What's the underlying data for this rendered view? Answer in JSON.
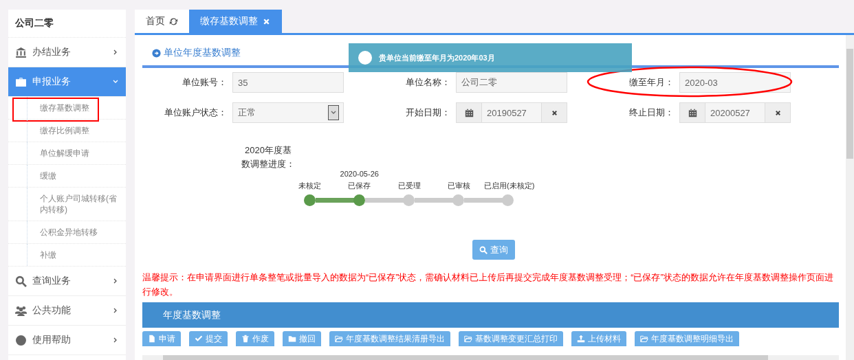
{
  "sidebar": {
    "title": "公司二零",
    "items": [
      {
        "label": "办结业务",
        "expanded": false,
        "selected": false
      },
      {
        "label": "申报业务",
        "expanded": true,
        "selected": true,
        "children": [
          {
            "label": "缴存基数调整",
            "annotated": true
          },
          {
            "label": "缴存比例调整",
            "annotated": false
          },
          {
            "label": "单位解缓申请",
            "annotated": false
          },
          {
            "label": "缓缴",
            "annotated": false
          },
          {
            "label": "个人账户司城转移(省内转移)",
            "annotated": false
          },
          {
            "label": "公积金异地转移",
            "annotated": false
          },
          {
            "label": "补缴",
            "annotated": false
          }
        ]
      },
      {
        "label": "查询业务",
        "expanded": false,
        "selected": false
      },
      {
        "label": "公共功能",
        "expanded": false,
        "selected": false
      },
      {
        "label": "使用帮助",
        "expanded": false,
        "selected": false
      }
    ]
  },
  "tabs": [
    {
      "label": "首页",
      "selected": false
    },
    {
      "label": "缴存基数调整",
      "selected": true
    }
  ],
  "section_title": "单位年度基数调整",
  "toast": {
    "message": "贵单位当前缴至年月为2020年03月"
  },
  "form": {
    "fields": [
      {
        "label": "单位账号：",
        "kind": "text",
        "value": "35"
      },
      {
        "label": "单位名称：",
        "kind": "text",
        "value": "公司二零"
      },
      {
        "label": "缴至年月：",
        "kind": "text",
        "value": "2020-03",
        "annotated": true
      },
      {
        "label": "单位账户状态：",
        "kind": "select",
        "value": "正常"
      },
      {
        "label": "开始日期：",
        "kind": "date",
        "value": "20190527"
      },
      {
        "label": "终止日期：",
        "kind": "date",
        "value": "20200527"
      }
    ]
  },
  "progress": {
    "label": "2020年度基数调整进度：",
    "steps": [
      {
        "label": "未核定",
        "done": true
      },
      {
        "label": "已保存",
        "done": true,
        "date": "2020-05-26"
      },
      {
        "label": "已受理",
        "done": false
      },
      {
        "label": "已审核",
        "done": false
      },
      {
        "label": "已启用(未核定)",
        "done": false
      }
    ]
  },
  "query_button": "查询",
  "warning": "温馨提示：在申请界面进行单条整笔或批量导入的数据为“已保存”状态，需确认材料已上传后再提交完成年度基数调整受理；“已保存”状态的数据允许在年度基数调整操作页面进行修改。",
  "grid_title": "年度基数调整",
  "actions": [
    {
      "label": "申请"
    },
    {
      "label": "提交"
    },
    {
      "label": "作废"
    },
    {
      "label": "撤回"
    },
    {
      "label": "年度基数调整结果清册导出"
    },
    {
      "label": "基数调整变更汇总打印"
    },
    {
      "label": "上传材料"
    },
    {
      "label": "年度基数调整明细导出"
    }
  ]
}
